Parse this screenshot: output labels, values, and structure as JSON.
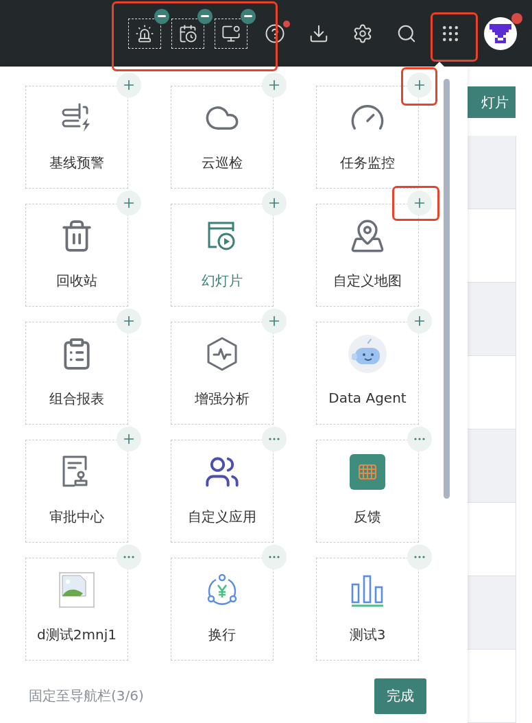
{
  "top_bar": {
    "pinned": [
      {
        "kind": "alarm"
      },
      {
        "kind": "calendar-clock"
      },
      {
        "kind": "monitor-pulse"
      }
    ],
    "tools": [
      {
        "kind": "help",
        "badge": true
      },
      {
        "kind": "download",
        "badge": false
      },
      {
        "kind": "settings",
        "badge": false
      },
      {
        "kind": "search",
        "badge": false
      },
      {
        "kind": "apps",
        "badge": false
      }
    ],
    "avatar": {
      "badge": true
    }
  },
  "apps": [
    {
      "label": "基线预警",
      "kind": "baseline",
      "pinnable": true,
      "selected": false
    },
    {
      "label": "云巡检",
      "kind": "cloud",
      "pinnable": true,
      "selected": false
    },
    {
      "label": "任务监控",
      "kind": "gauge",
      "pinnable": true,
      "selected": false
    },
    {
      "label": "回收站",
      "kind": "trash",
      "pinnable": true,
      "selected": false
    },
    {
      "label": "幻灯片",
      "kind": "slides",
      "pinnable": true,
      "selected": true
    },
    {
      "label": "自定义地图",
      "kind": "map",
      "pinnable": true,
      "selected": false
    },
    {
      "label": "组合报表",
      "kind": "clipboard",
      "pinnable": true,
      "selected": false
    },
    {
      "label": "增强分析",
      "kind": "hex-pulse",
      "pinnable": true,
      "selected": false
    },
    {
      "label": "Data Agent",
      "kind": "robot",
      "pinnable": true,
      "selected": false
    },
    {
      "label": "审批中心",
      "kind": "approval",
      "pinnable": true,
      "selected": false
    },
    {
      "label": "自定义应用",
      "kind": "users",
      "pinnable": false,
      "selected": false
    },
    {
      "label": "反馈",
      "kind": "feedback",
      "pinnable": false,
      "selected": false
    },
    {
      "label": "d测试2mnj1",
      "kind": "broken-image",
      "pinnable": false,
      "selected": false
    },
    {
      "label": "换行",
      "kind": "yen-network",
      "pinnable": false,
      "selected": false
    },
    {
      "label": "测试3",
      "kind": "bar-chart",
      "pinnable": false,
      "selected": false
    }
  ],
  "footer": {
    "pin_status": "固定至导航栏(3/6)",
    "done_button": "完成"
  },
  "background": {
    "button": "灯片"
  }
}
